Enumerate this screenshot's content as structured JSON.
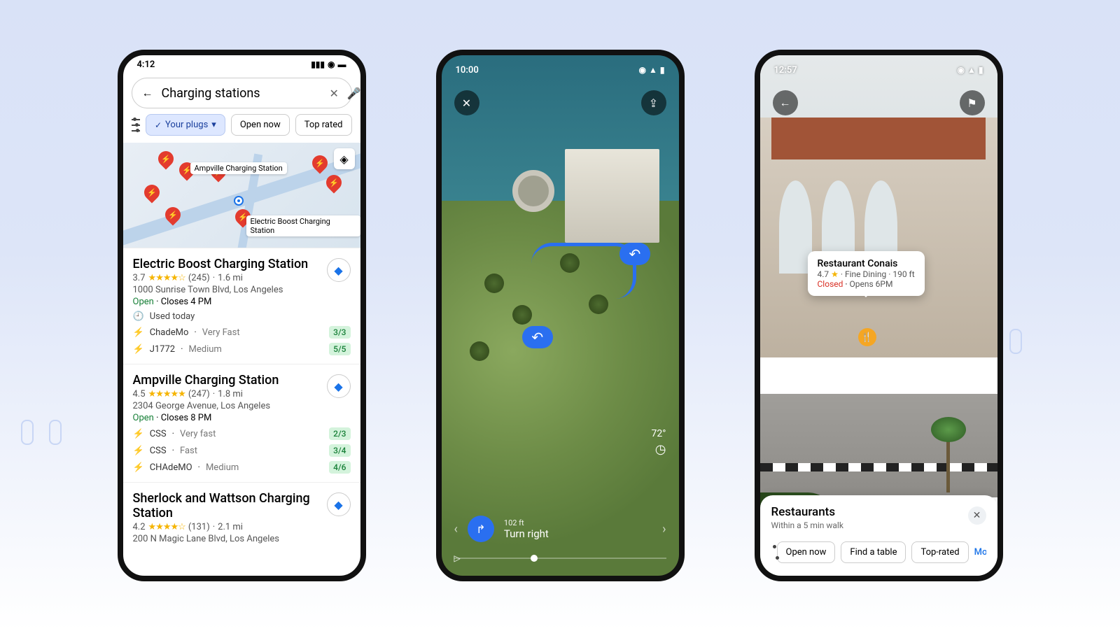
{
  "phone1": {
    "status_time": "4:12",
    "search": {
      "value": "Charging stations"
    },
    "filter_selected": "Your plugs",
    "filter_open_now": "Open now",
    "filter_top_rated": "Top rated",
    "map_label1": "Ampville Charging Station",
    "map_label2": "Electric Boost Charging Station",
    "results": [
      {
        "name": "Electric Boost Charging Station",
        "rating": "3.7",
        "stars": "★★★★☆",
        "reviews": "(245)",
        "distance": "1.6 mi",
        "address": "1000 Sunrise Town Blvd, Los Angeles",
        "open": "Open",
        "closes": "Closes 4 PM",
        "used": "Used today",
        "plugs": [
          {
            "type": "ChadeMo",
            "speed": "Very Fast",
            "avail": "3/3"
          },
          {
            "type": "J1772",
            "speed": "Medium",
            "avail": "5/5"
          }
        ]
      },
      {
        "name": "Ampville Charging Station",
        "rating": "4.5",
        "stars": "★★★★★",
        "reviews": "(247)",
        "distance": "1.8 mi",
        "address": "2304 George Avenue, Los Angeles",
        "open": "Open",
        "closes": "Closes 8 PM",
        "plugs": [
          {
            "type": "CSS",
            "speed": "Very fast",
            "avail": "2/3"
          },
          {
            "type": "CSS",
            "speed": "Fast",
            "avail": "3/4"
          },
          {
            "type": "CHAdeMO",
            "speed": "Medium",
            "avail": "4/6"
          }
        ]
      },
      {
        "name": "Sherlock and Wattson Charging Station",
        "rating": "4.2",
        "stars": "★★★★☆",
        "reviews": "(131)",
        "distance": "2.1 mi",
        "address": "200 N Magic Lane Blvd, Los Angeles"
      }
    ]
  },
  "phone2": {
    "status_time": "10:00",
    "temperature": "72°",
    "nav_distance": "102 ft",
    "nav_instruction": "Turn right"
  },
  "phone3": {
    "status_time": "12:57",
    "tooltip": {
      "name": "Restaurant Conais",
      "rating": "4.7",
      "star": "★",
      "category": "Fine Dining",
      "distance": "190 ft",
      "status": "Closed",
      "opens": "Opens 6PM"
    },
    "sheet": {
      "title": "Restaurants",
      "subtitle": "Within a 5 min walk",
      "chip_open": "Open now",
      "chip_table": "Find a table",
      "chip_top": "Top-rated",
      "more": "More"
    }
  }
}
